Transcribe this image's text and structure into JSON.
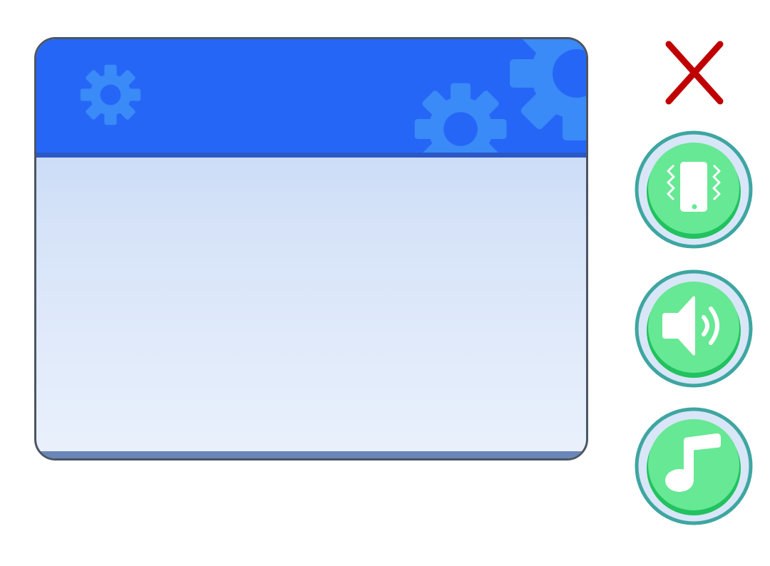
{
  "settings_panel": {
    "header_color": "#2566f7",
    "body_gradient": [
      "#bdd2f6",
      "#eaf1fc"
    ],
    "decoration": "gear-icon"
  },
  "close_button": {
    "icon": "close-icon",
    "color": "#c00000"
  },
  "buttons": [
    {
      "id": "vibration",
      "icon": "vibration-icon",
      "color": "#67e894",
      "ring": "#3ea6a0"
    },
    {
      "id": "sound",
      "icon": "speaker-icon",
      "color": "#67e894",
      "ring": "#3ea6a0"
    },
    {
      "id": "music",
      "icon": "music-note-icon",
      "color": "#67e894",
      "ring": "#3ea6a0"
    }
  ]
}
